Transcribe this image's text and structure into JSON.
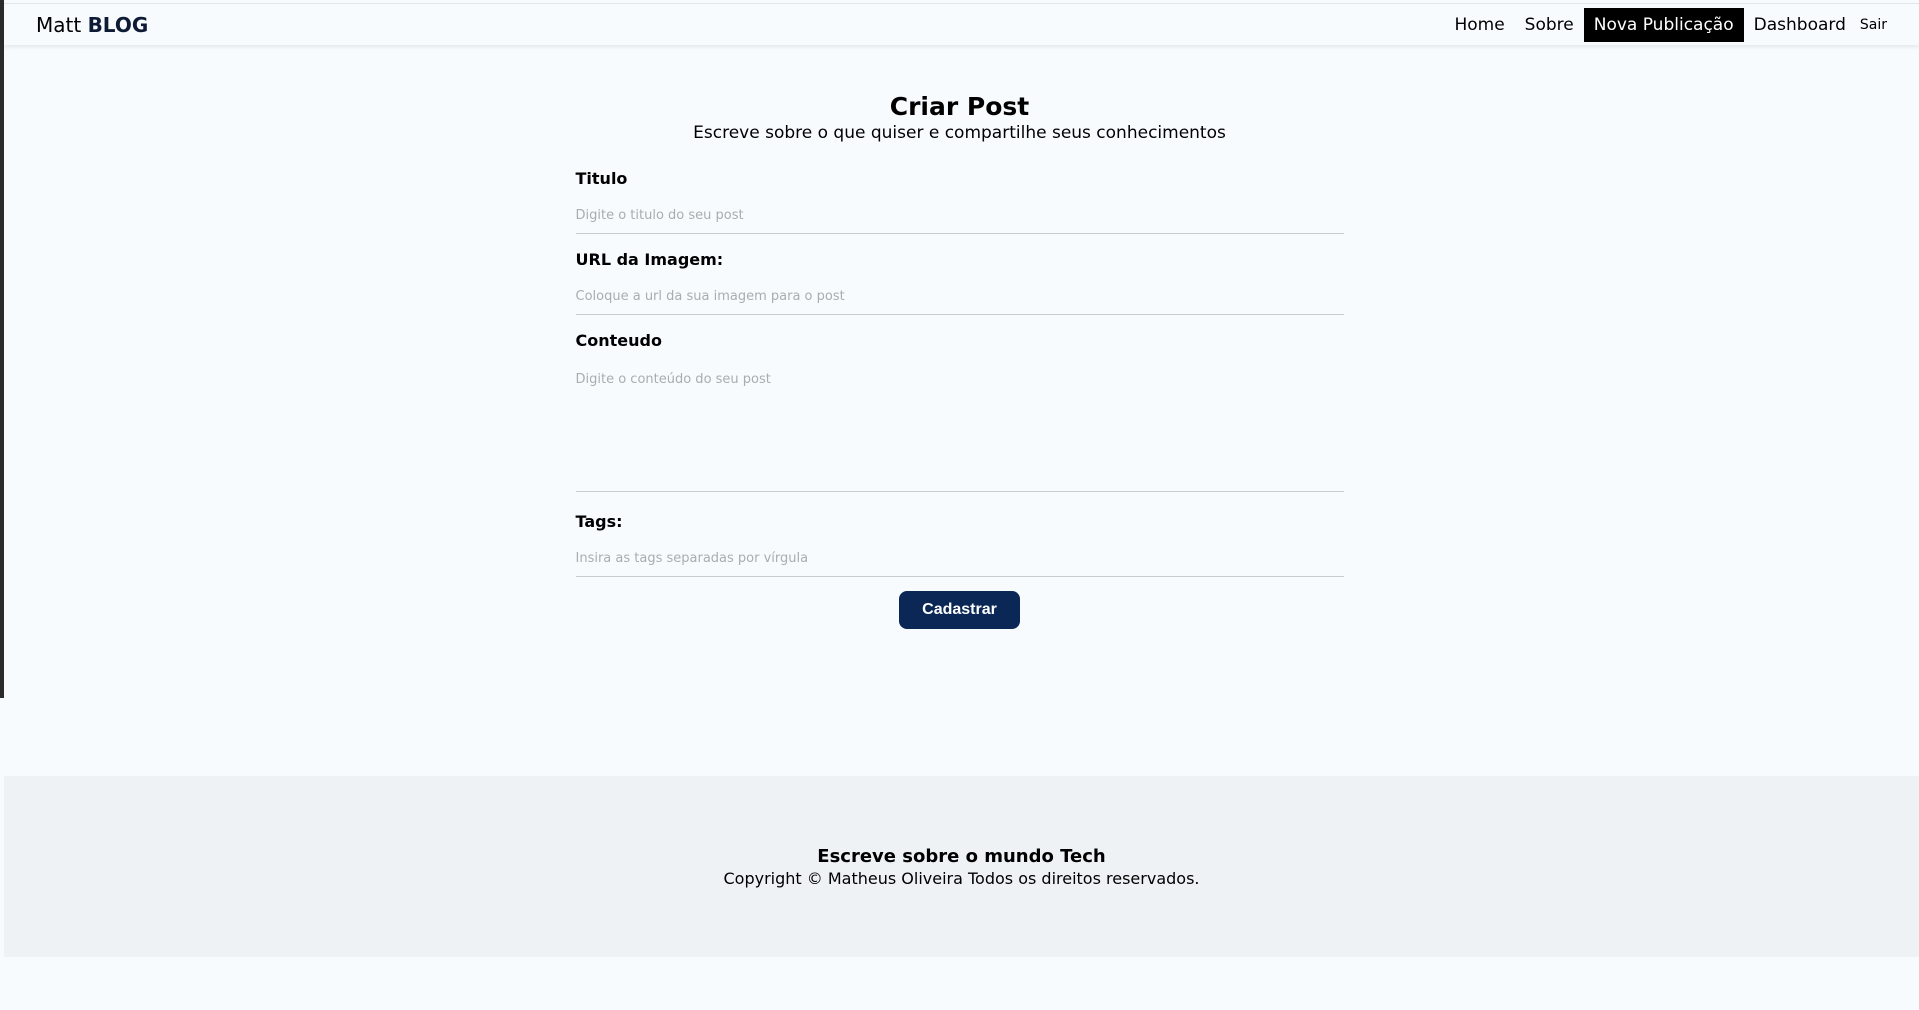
{
  "navbar": {
    "brand_light": "Matt",
    "brand_strong": "BLOG",
    "links": [
      {
        "label": "Home"
      },
      {
        "label": "Sobre"
      },
      {
        "label": "Nova Publicação"
      },
      {
        "label": "Dashboard"
      },
      {
        "label": "Sair"
      }
    ]
  },
  "page": {
    "title": "Criar Post",
    "subtitle": "Escreve sobre o que quiser e compartilhe seus conhecimentos"
  },
  "form": {
    "title_label": "Titulo",
    "title_placeholder": "Digite o titulo do seu post",
    "image_label": "URL da Imagem:",
    "image_placeholder": "Coloque a url da sua imagem para o post",
    "content_label": "Conteudo",
    "content_placeholder": "Digite o conteúdo do seu post",
    "tags_label": "Tags:",
    "tags_placeholder": "Insira as tags separadas por vírgula",
    "submit_label": "Cadastrar"
  },
  "footer": {
    "title": "Escreve sobre o mundo Tech",
    "copyright": "Copyright © Matheus Oliveira Todos os direitos reservados."
  },
  "colors": {
    "background": "#f7fbfe",
    "accent": "#0a2756",
    "footer_bg": "#eef2f5"
  }
}
